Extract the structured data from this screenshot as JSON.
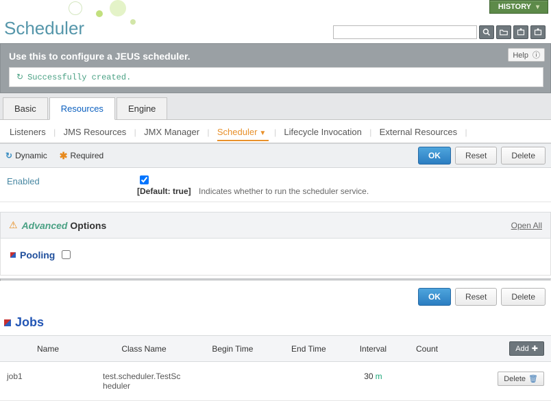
{
  "history_label": "HISTORY",
  "page_title": "Scheduler",
  "search": {
    "placeholder": ""
  },
  "banner": {
    "title": "Use this to configure a JEUS scheduler.",
    "help_label": "Help",
    "flash": "Successfully created."
  },
  "tabs": {
    "items": [
      "Basic",
      "Resources",
      "Engine"
    ],
    "active_index": 1
  },
  "subnav": {
    "items": [
      "Listeners",
      "JMS Resources",
      "JMX Manager",
      "Scheduler",
      "Lifecycle Invocation",
      "External Resources"
    ],
    "active_index": 3
  },
  "legend": {
    "dynamic": "Dynamic",
    "required": "Required"
  },
  "buttons": {
    "ok": "OK",
    "reset": "Reset",
    "delete": "Delete",
    "add": "Add"
  },
  "form": {
    "enabled": {
      "label": "Enabled",
      "checked": true,
      "default_text": "[Default: true]",
      "desc": "Indicates whether to run the scheduler service."
    }
  },
  "advanced": {
    "word_adv": "Advanced",
    "word_opt": "Options",
    "open_all": "Open All",
    "pooling": "Pooling"
  },
  "jobs": {
    "title": "Jobs",
    "columns": [
      "Name",
      "Class Name",
      "Begin Time",
      "End Time",
      "Interval",
      "Count",
      ""
    ],
    "rows": [
      {
        "name": "job1",
        "class_name": "test.scheduler.TestScheduler",
        "begin_time": "",
        "end_time": "",
        "interval_value": "30",
        "interval_unit": "m",
        "count": ""
      }
    ]
  }
}
